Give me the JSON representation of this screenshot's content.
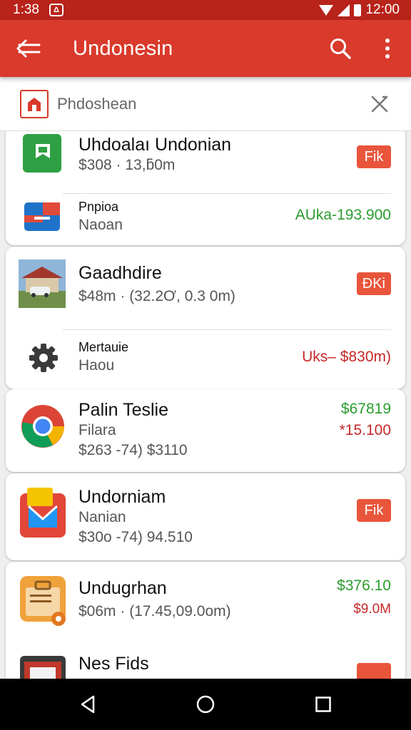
{
  "status_bar": {
    "time": "1:38",
    "notification_glyph": "Δ",
    "clock": "12:00"
  },
  "app_bar": {
    "title": "Undonesin",
    "icons": [
      "back-arrow-icon",
      "search-icon",
      "more-vert-icon"
    ]
  },
  "search": {
    "value": "Phdoshean",
    "placeholder": "Phdoshean"
  },
  "items": [
    {
      "title": "Uhdoalaı Undonian",
      "subtitle": "$308 · 13,ƃ0m",
      "badge": "Fik"
    },
    {
      "title": "Pnpioa",
      "subtitle": "Naoan",
      "price": "AUka-193.900"
    },
    {
      "title": "Gaadhdire",
      "subtitle": "$48m · (32.2Ơ, 0.3 0m)",
      "badge": "ÐKi"
    },
    {
      "title": "Mertauie",
      "subtitle": "Haou",
      "price": "Uks– $830m)"
    },
    {
      "title": "Palin Teslie",
      "subtitle": "Filara",
      "subtitle2": "$263 -74) $3110",
      "price": "$67819",
      "price2": "*15.100"
    },
    {
      "title": "Undorniam",
      "subtitle": "Nanian",
      "subtitle2": "$30o -74) 94.510",
      "badge": "Fik"
    },
    {
      "title": "Undugrhan",
      "subtitle": "$06m · (17.45,09.0om)",
      "price": "$376.10",
      "price2": "$9.0M"
    },
    {
      "title": "Nes Fids"
    }
  ],
  "colors": {
    "primary": "#d93a2b",
    "status_bar": "#b8231a",
    "badge": "#e8553b",
    "positive": "#2a9c2e",
    "negative": "#c62828"
  },
  "nav_bar": {
    "icons": [
      "nav-back-icon",
      "nav-home-icon",
      "nav-recents-icon"
    ]
  }
}
